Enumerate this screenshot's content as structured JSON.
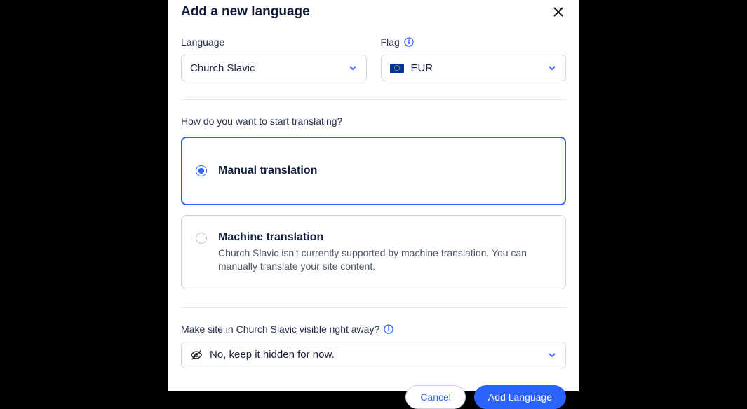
{
  "modal": {
    "title": "Add a new language",
    "fields": {
      "language": {
        "label": "Language",
        "value": "Church Slavic"
      },
      "flag": {
        "label": "Flag",
        "value": "EUR"
      }
    },
    "translation": {
      "question": "How do you want to start translating?",
      "options": {
        "manual": {
          "title": "Manual translation"
        },
        "machine": {
          "title": "Machine translation",
          "description": "Church Slavic isn't currently supported by machine translation. You can manually translate your site content."
        }
      }
    },
    "visibility": {
      "label": "Make site in Church Slavic visible right away?",
      "value": "No, keep it hidden for now."
    },
    "buttons": {
      "cancel": "Cancel",
      "submit": "Add Language"
    }
  }
}
